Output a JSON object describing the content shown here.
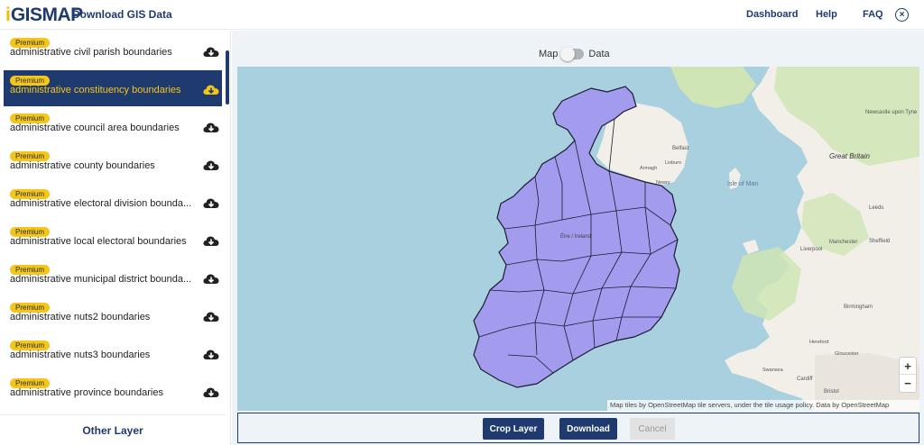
{
  "header": {
    "logo_i": "i",
    "logo_rest": "GISMAP",
    "title": "Download GIS Data",
    "nav": [
      "Dashboard",
      "Help",
      "FAQ"
    ],
    "close_symbol": "×"
  },
  "sidebar": {
    "items": [
      {
        "badge": "Premium",
        "label": "administrative civil parish boundaries"
      },
      {
        "badge": "Premium",
        "label": "administrative constituency boundaries"
      },
      {
        "badge": "Premium",
        "label": "administrative council area boundaries"
      },
      {
        "badge": "Premium",
        "label": "administrative county boundaries"
      },
      {
        "badge": "Premium",
        "label": "administrative electoral division bounda..."
      },
      {
        "badge": "Premium",
        "label": "administrative local electoral boundaries"
      },
      {
        "badge": "Premium",
        "label": "administrative municipal district bounda..."
      },
      {
        "badge": "Premium",
        "label": "administrative nuts2 boundaries"
      },
      {
        "badge": "Premium",
        "label": "administrative nuts3 boundaries"
      },
      {
        "badge": "Premium",
        "label": "administrative province boundaries"
      }
    ],
    "active_index": 1,
    "other_layer": "Other Layer"
  },
  "toggle": {
    "left": "Map",
    "right": "Data"
  },
  "map": {
    "labels": {
      "great_britain": "Great Britain",
      "isle_of_man": "Isle of Man",
      "belfast": "Belfast",
      "newcastle": "Newcastle upon Tyne",
      "leeds": "Leeds",
      "manchester": "Manchester",
      "liverpool": "Liverpool",
      "sheffield": "Sheffield",
      "birmingham": "Birmingham",
      "cardiff": "Cardiff",
      "bristol": "Bristol",
      "swansea": "Swansea",
      "gloucester": "Gloucester",
      "hereford": "Hereford",
      "armagh": "Armagh",
      "lisburn": "Lisburn",
      "newry": "Newry",
      "eire": "Éire / Ireland"
    },
    "zoom_in": "+",
    "zoom_out": "−",
    "attribution": "Map tiles by OpenStreetMap tile servers, under the tile usage policy. Data by OpenStreetMap"
  },
  "actions": {
    "crop": "Crop Layer",
    "download": "Download",
    "cancel": "Cancel"
  },
  "colors": {
    "navy": "#1e3a6e",
    "premium": "#f5c518",
    "sea": "#a8d0de",
    "land": "#f2efe9",
    "green": "#cfe5b5",
    "ireland_fill": "#a39bee"
  }
}
